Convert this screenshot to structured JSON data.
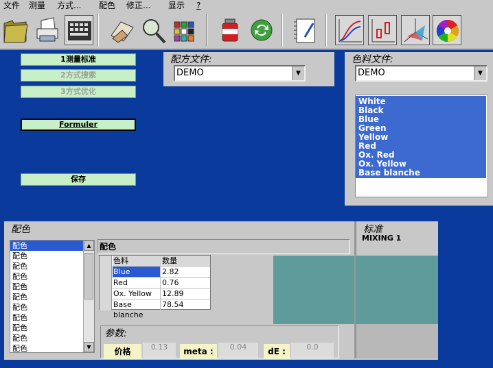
{
  "menu": [
    "文件",
    "测量",
    "方式...",
    "配色",
    "修正...",
    "显示",
    "?"
  ],
  "toolbar": {
    "icons": [
      "folder-icon",
      "printer-icon",
      "keyboard-icon",
      "hand-paper-icon",
      "magnifier-icon",
      "color-grid-icon",
      "paint-can-icon",
      "refresh-icon",
      "notebook-icon",
      "curve-chart-icon",
      "box-plot-icon",
      "3d-axes-icon",
      "color-wheel-icon"
    ]
  },
  "actions": {
    "measure_standard": "1测量标准",
    "method_search": "2方式搜索",
    "method_optimize": "3方式优化",
    "formuler": "Formuler",
    "save": "保存"
  },
  "formula_file": {
    "title": "配方文件:",
    "value": "DEMO"
  },
  "colorant_file": {
    "title": "色料文件:",
    "value": "DEMO",
    "colorants": [
      "White",
      "Black",
      "Blue",
      "Green",
      "Yellow",
      "Red",
      "Ox. Red",
      "Ox. Yellow",
      "Base blanche"
    ]
  },
  "match": {
    "title": "配色",
    "list_items": [
      "配色",
      "配色",
      "配色",
      "配色",
      "配色",
      "配色",
      "配色",
      "配色",
      "配色",
      "配色",
      "配色"
    ],
    "subtitle": "配色",
    "table": {
      "headers": [
        "色料",
        "数量"
      ],
      "rows": [
        [
          "Blue",
          "2.82"
        ],
        [
          "Red",
          "0.76"
        ],
        [
          "Ox. Yellow",
          "12.89"
        ],
        [
          "Base blanche",
          "78.54"
        ]
      ]
    },
    "swatch_color": "#5f9b9b"
  },
  "standard": {
    "title": "标准",
    "name": "MIXING 1"
  },
  "params": {
    "title": "参数:",
    "price_label": "价格",
    "price_value": "0.13",
    "meta_label": "meta :",
    "meta_value": "0.04",
    "de_label": "dE :",
    "de_value": "0.0"
  }
}
